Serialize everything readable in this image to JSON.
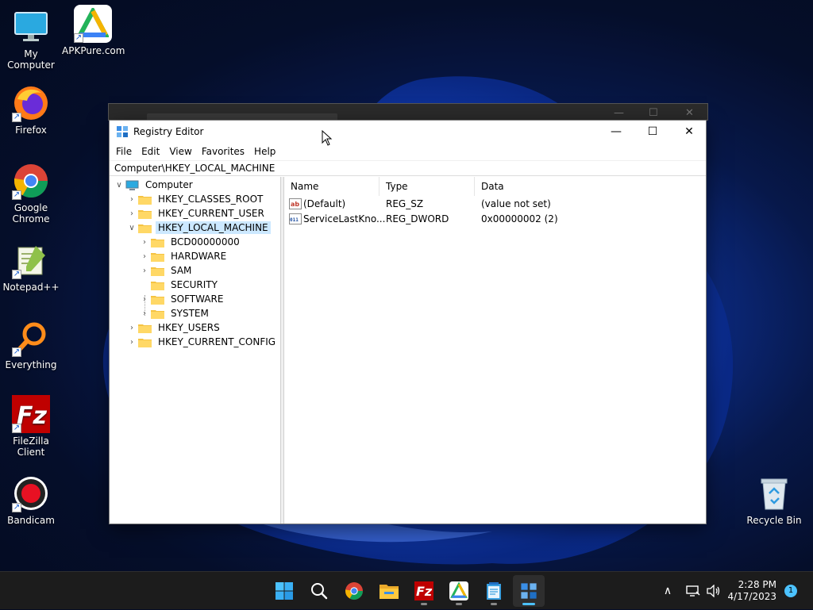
{
  "desktop": {
    "icons": [
      {
        "label": "My Computer"
      },
      {
        "label": "APKPure.com"
      },
      {
        "label": "Firefox"
      },
      {
        "label": "Google Chrome"
      },
      {
        "label": "Notepad++"
      },
      {
        "label": "Everything"
      },
      {
        "label": "FileZilla Client"
      },
      {
        "label": "Bandicam"
      },
      {
        "label": "Recycle Bin"
      }
    ]
  },
  "window": {
    "title": "Registry Editor",
    "controls": {
      "minimize": "—",
      "maximize": "☐",
      "close": "✕"
    },
    "menu": [
      "File",
      "Edit",
      "View",
      "Favorites",
      "Help"
    ],
    "address": "Computer\\HKEY_LOCAL_MACHINE",
    "tree": [
      {
        "label": "Computer",
        "chevron": "∨"
      },
      {
        "label": "HKEY_CLASSES_ROOT",
        "chevron": "›"
      },
      {
        "label": "HKEY_CURRENT_USER",
        "chevron": "›"
      },
      {
        "label": "HKEY_LOCAL_MACHINE",
        "chevron": "∨"
      },
      {
        "label": "BCD00000000",
        "chevron": "›"
      },
      {
        "label": "HARDWARE",
        "chevron": "›"
      },
      {
        "label": "SAM",
        "chevron": "›"
      },
      {
        "label": "SECURITY",
        "chevron": ""
      },
      {
        "label": "SOFTWARE",
        "chevron": "›"
      },
      {
        "label": "SYSTEM",
        "chevron": "›"
      },
      {
        "label": "HKEY_USERS",
        "chevron": "›"
      },
      {
        "label": "HKEY_CURRENT_CONFIG",
        "chevron": "›"
      }
    ],
    "columns": [
      "Name",
      "Type",
      "Data"
    ],
    "values": [
      {
        "name": "(Default)",
        "type": "REG_SZ",
        "data": "(value not set)",
        "icon_text": "ab"
      },
      {
        "name": "ServiceLastKno...",
        "type": "REG_DWORD",
        "data": "0x00000002 (2)",
        "icon_text": "011"
      }
    ]
  },
  "taskbar": {
    "time": "2:28 PM",
    "date": "4/17/2023",
    "notification_count": "1",
    "tray_chevron": "∧"
  },
  "colors": {
    "selection": "#cce8ff",
    "folder": "#f5c342",
    "accent": "#4cc2ff",
    "taskbar": "#1c1c1c"
  }
}
